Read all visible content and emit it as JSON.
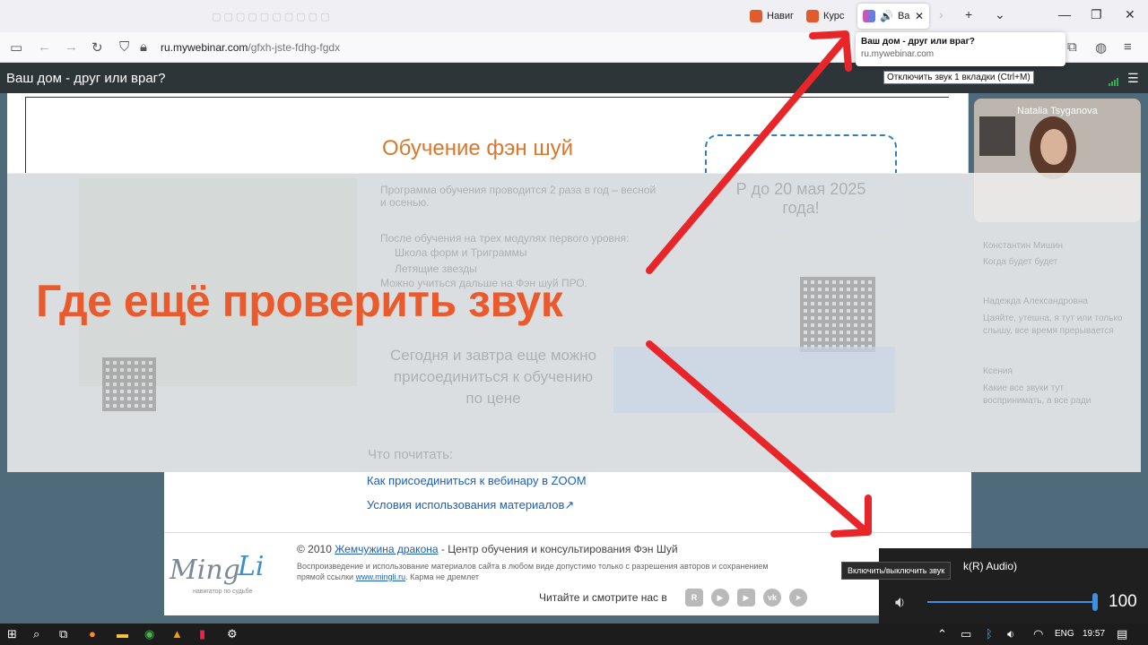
{
  "browser": {
    "tabs": [
      {
        "label": "Навиг"
      },
      {
        "label": "Курс"
      },
      {
        "label": "Ва"
      }
    ],
    "tab_tooltip": {
      "title": "Ваш дом - друг или враг?",
      "domain": "ru.mywebinar.com"
    },
    "mute_tooltip": "Отключить звук 1 вкладки (Ctrl+M)",
    "url_host": "ru.mywebinar.com",
    "url_path": "/gfxh-jste-fdhg-fgdx"
  },
  "site": {
    "title": "Ваш дом - друг или враг?"
  },
  "slide": {
    "title": "Обучение фэн шуй",
    "dashed_text": "Р до 20 мая 2025 года!",
    "para1": "Программа обучения проводится 2 раза в год – весной и осенью.",
    "para2": "После обучения на трех модулях первого уровня:",
    "bullet1": "Школа форм и Триграммы",
    "bullet2": "Летящие звезды",
    "para3": "Можно учиться дальше на Фэн шуй ПРО.",
    "faded_big": "Сегодня и завтра еще можно присоединиться к обучению по цене",
    "read_label": "Что почитать:"
  },
  "overlay": {
    "headline": "Где ещё проверить звук"
  },
  "video": {
    "participant": "Natalia Tsyganova"
  },
  "chat": {
    "msg1_name": "Константин Мишин",
    "msg1_text": "Когда будет будет",
    "msg2_name": "Надежда Александровна",
    "msg2_text": "Цаяйте, утешна, я тут или только слышу, все время прерывается",
    "msg3_name": "Ксения",
    "msg3_text": "Какие все звуки тут воспринимать, а все ради"
  },
  "links": {
    "zoom": "Как присоединиться к вебинару в ZOOM",
    "terms": "Условия использования материалов↗"
  },
  "footer": {
    "copyright_prefix": "© 2010",
    "copyright_link": "Жемчужина дракона",
    "copyright_suffix": "- Центр обучения и консультирования Фэн Шуй",
    "legal_text": "Воспроизведение и использование материалов сайта в любом виде допустимо только с разрешения авторов и сохранением прямой ссылки",
    "legal_link": "www.mingli.ru",
    "legal_tail": ". Карма не дремлет",
    "social_label": "Читайте и смотрите нас в",
    "logo_m": "Ming",
    "logo_l": "Li",
    "logo_tag": "навигатор по судьбе"
  },
  "volume": {
    "toggle_tooltip": "Включить/выключить звук",
    "device": "k(R) Audio)",
    "value": "100",
    "level": 1.0
  },
  "taskbar": {
    "lang": "ENG",
    "time": "19:57"
  },
  "colors": {
    "headline": "#ea5a2c",
    "arrow": "#e8262a",
    "link": "#1f5fb6"
  }
}
